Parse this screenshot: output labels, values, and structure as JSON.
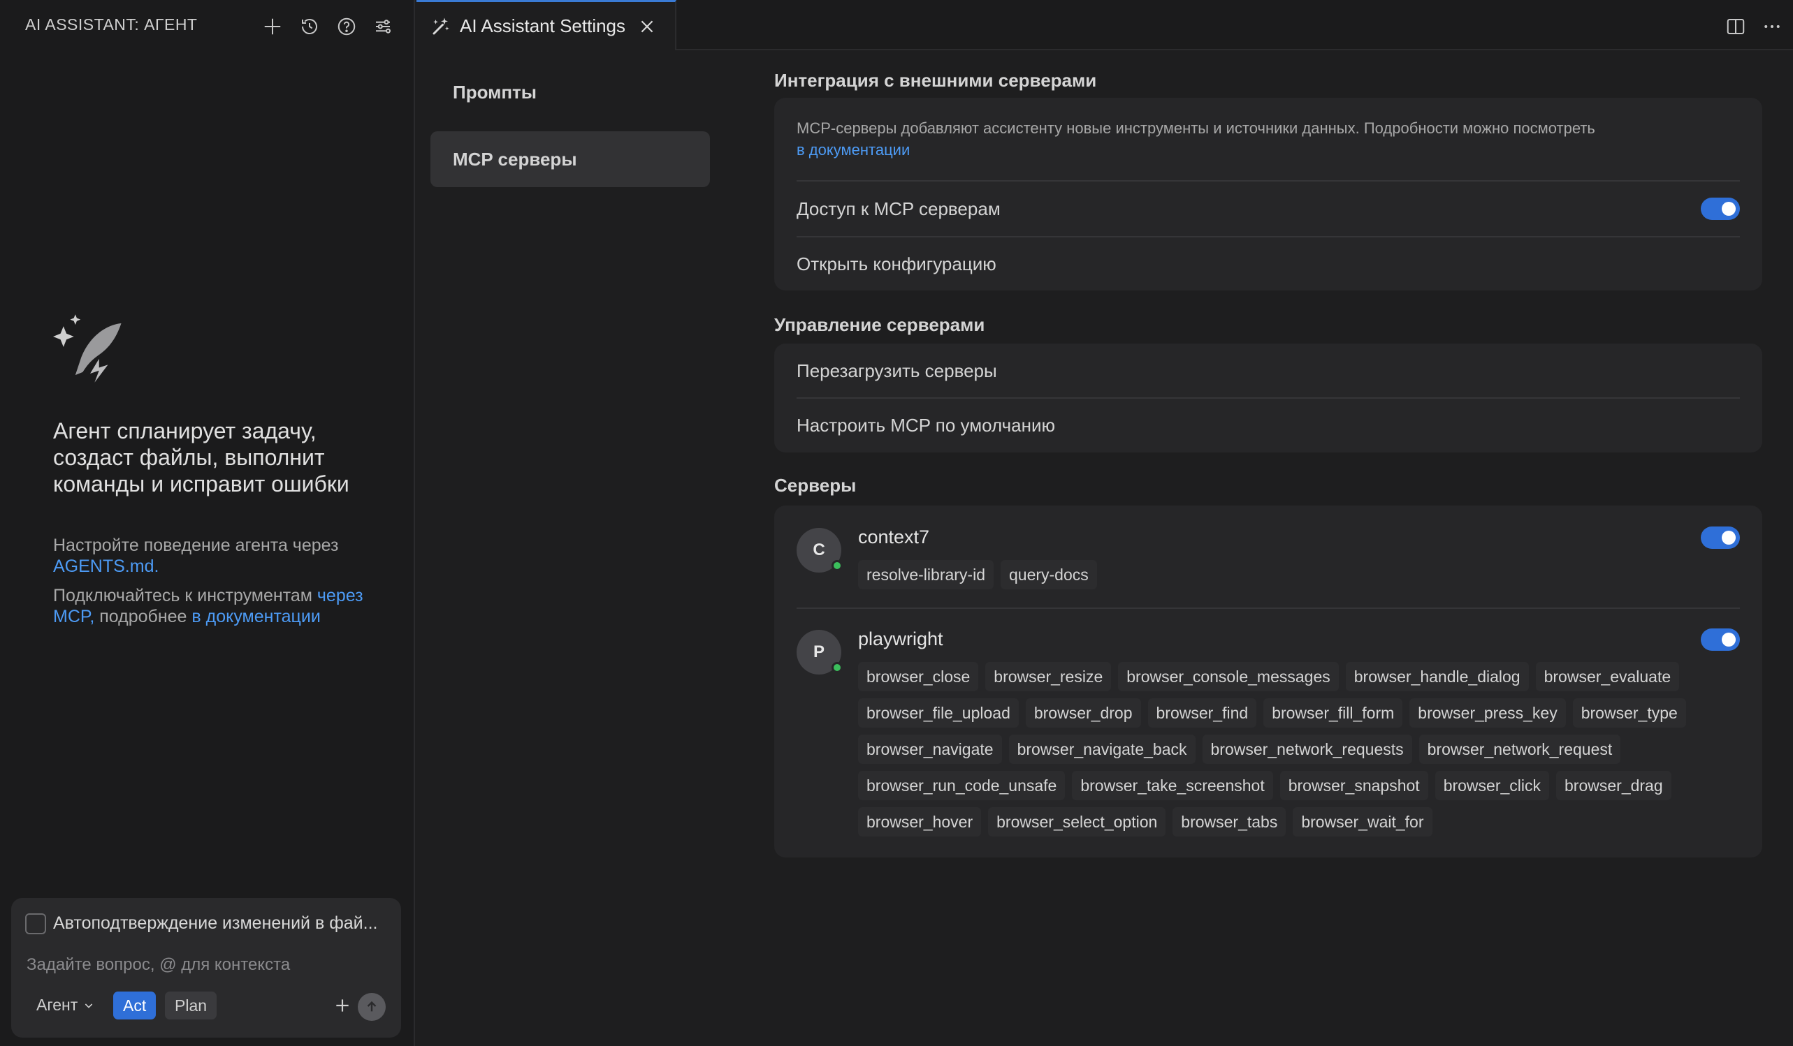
{
  "left_panel": {
    "title": "AI ASSISTANT: АГЕНТ",
    "header_icons": [
      "plus-icon",
      "history-icon",
      "help-icon",
      "sliders-icon"
    ],
    "hero": {
      "title": "Агент спланирует задачу, создаст файлы, выполнит команды и исправит ошибки",
      "p1_text": "Настройте поведение агента через ",
      "p1_link": "AGENTS.md.",
      "p2_text": "Подключайтесь к инструментам ",
      "p2_link1": "через MCP,",
      "p2_middle": " подробнее ",
      "p2_link2": "в документации"
    },
    "input": {
      "auto_confirm_label": "Автоподтверждение изменений в фай...",
      "placeholder": "Задайте вопрос, @ для контекста",
      "mode_label": "Агент",
      "act_label": "Act",
      "plan_label": "Plan"
    }
  },
  "tab": {
    "label": "AI Assistant Settings"
  },
  "settings_nav": {
    "items": [
      {
        "label": "Промпты",
        "active": false
      },
      {
        "label": "MCP серверы",
        "active": true
      }
    ]
  },
  "integration": {
    "title": "Интеграция с внешними серверами",
    "description": "MCP-серверы добавляют ассистенту новые инструменты и источники данных. Подробности можно посмотреть",
    "doc_link": "в документации",
    "access_label": "Доступ к MCP серверам",
    "access_enabled": true,
    "open_config_label": "Открыть конфигурацию"
  },
  "management": {
    "title": "Управление серверами",
    "reload_label": "Перезагрузить серверы",
    "configure_default_label": "Настроить MCP по умолчанию"
  },
  "servers": {
    "title": "Серверы",
    "items": [
      {
        "initial": "C",
        "name": "context7",
        "enabled": true,
        "tools": [
          "resolve-library-id",
          "query-docs"
        ]
      },
      {
        "initial": "P",
        "name": "playwright",
        "enabled": true,
        "tools": [
          "browser_close",
          "browser_resize",
          "browser_console_messages",
          "browser_handle_dialog",
          "browser_evaluate",
          "browser_file_upload",
          "browser_drop",
          "browser_find",
          "browser_fill_form",
          "browser_press_key",
          "browser_type",
          "browser_navigate",
          "browser_navigate_back",
          "browser_network_requests",
          "browser_network_request",
          "browser_run_code_unsafe",
          "browser_take_screenshot",
          "browser_snapshot",
          "browser_click",
          "browser_drag",
          "browser_hover",
          "browser_select_option",
          "browser_tabs",
          "browser_wait_for"
        ]
      }
    ]
  },
  "colors": {
    "accent": "#2f6fd8",
    "link": "#4d9bf5",
    "status_online": "#3bbf5c"
  }
}
